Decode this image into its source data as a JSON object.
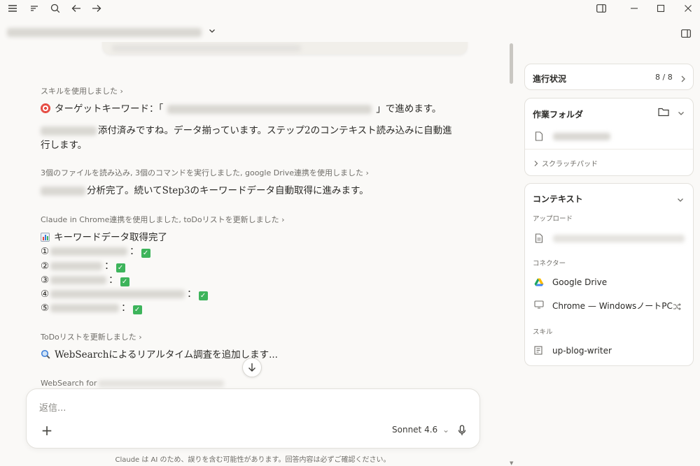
{
  "window": {
    "icons": {
      "menu": "hamburger-icon",
      "sidebar_toggle": "list-icon",
      "search": "search-icon",
      "back": "arrow-left-icon",
      "forward": "arrow-right-icon",
      "panel": "panel-icon",
      "minimize": "minimize-icon",
      "maximize": "maximize-icon",
      "close": "close-icon"
    }
  },
  "chat": {
    "messages": [
      {
        "meta": "スキルを使用しました ›"
      },
      {
        "text_prefix": "ターゲットキーワード：「",
        "text_suffix": "」で進めます。"
      },
      {
        "text_a": "添付済みですね。データ揃っています。ステップ",
        "text_b": "2",
        "text_c": "のコンテキスト読み込みに自動進",
        "line2": "行します。"
      },
      {
        "meta": "3個のファイルを読み込み, 3個のコマンドを実行しました, google Drive連携を使用しました ›"
      },
      {
        "text_a": "分析完了。続いて",
        "text_b": "Step3",
        "text_c": "のキーワードデータ自動取得に進みます。"
      },
      {
        "meta": "Claude in Chrome連携を使用しました, toDoリストを更新しました ›"
      },
      {
        "heading": "キーワードデータ取得完了",
        "items": [
          "①",
          "②",
          "③",
          "④",
          "⑤"
        ],
        "sep": "：",
        "check": "✓"
      },
      {
        "meta": "ToDoリストを更新しました ›"
      },
      {
        "text_a": "WebSearch",
        "text_b": "によるリアルタイム調査を追加します..."
      },
      {
        "meta": "WebSearch for"
      }
    ]
  },
  "composer": {
    "placeholder": "返信...",
    "model": "Sonnet 4.6",
    "model_chevron": "⌄",
    "plus": "+"
  },
  "disclaimer": "Claude は AI のため、誤りを含む可能性があります。回答内容は必ずご確認ください。",
  "panel": {
    "progress": {
      "label": "進行状況",
      "count": "8 / 8"
    },
    "folder": {
      "label": "作業フォルダ",
      "scratchpad": "スクラッチパッド"
    },
    "context": {
      "label": "コンテキスト",
      "upload_label": "アップロード",
      "connector_label": "コネクター",
      "connectors": [
        "Google Drive",
        "Chrome — WindowsノートPC"
      ],
      "skill_label": "スキル",
      "skills": [
        "up-blog-writer"
      ]
    }
  }
}
